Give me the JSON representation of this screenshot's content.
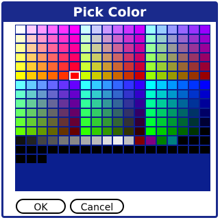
{
  "dialog": {
    "title": "Pick Color",
    "ok_label": "OK",
    "cancel_label": "Cancel"
  },
  "palette": {
    "columns": 18,
    "border_color": "#0b1f8e",
    "selected_index": 95,
    "colors": [
      "#ffffff",
      "#ffccff",
      "#ff99ff",
      "#ff66ff",
      "#ff33ff",
      "#ff00ff",
      "#ccffff",
      "#ccccff",
      "#cc99ff",
      "#cc66ff",
      "#cc33ff",
      "#cc00ff",
      "#99ffff",
      "#99ccff",
      "#9999ff",
      "#9966ff",
      "#9933ff",
      "#9900ff",
      "#ffffcc",
      "#ffcccc",
      "#ff99cc",
      "#ff66cc",
      "#ff33cc",
      "#ff00cc",
      "#ccffcc",
      "#cccccc",
      "#cc99cc",
      "#cc66cc",
      "#cc33cc",
      "#cc00cc",
      "#99ffcc",
      "#99cccc",
      "#9999cc",
      "#9966cc",
      "#9933cc",
      "#9900cc",
      "#ffff99",
      "#ffcc99",
      "#ff9999",
      "#ff6699",
      "#ff3399",
      "#ff0099",
      "#ccff99",
      "#cccc99",
      "#cc9999",
      "#cc6699",
      "#cc3399",
      "#cc0099",
      "#99ff99",
      "#99cc99",
      "#999999",
      "#996699",
      "#993399",
      "#990099",
      "#ffff66",
      "#ffcc66",
      "#ff9966",
      "#ff6666",
      "#ff3366",
      "#ff0066",
      "#ccff66",
      "#cccc66",
      "#cc9966",
      "#cc6666",
      "#cc3366",
      "#cc0066",
      "#99ff66",
      "#99cc66",
      "#999966",
      "#996666",
      "#993366",
      "#990066",
      "#ffff33",
      "#ffcc33",
      "#ff9933",
      "#ff6633",
      "#ff3333",
      "#ff0033",
      "#ccff33",
      "#cccc33",
      "#cc9933",
      "#cc6633",
      "#cc3333",
      "#cc0033",
      "#99ff33",
      "#99cc33",
      "#999933",
      "#996633",
      "#993333",
      "#990033",
      "#ffff00",
      "#ffcc00",
      "#ff9900",
      "#ff6600",
      "#ff3300",
      "#ff0000",
      "#ccff00",
      "#cccc00",
      "#cc9900",
      "#cc6600",
      "#cc3300",
      "#cc0000",
      "#99ff00",
      "#99cc00",
      "#999900",
      "#996600",
      "#993300",
      "#990000",
      "#66ffff",
      "#66ccff",
      "#6699ff",
      "#6666ff",
      "#6633ff",
      "#6600ff",
      "#33ffff",
      "#33ccff",
      "#3399ff",
      "#3366ff",
      "#3333ff",
      "#3300ff",
      "#00ffff",
      "#00ccff",
      "#0099ff",
      "#0066ff",
      "#0033ff",
      "#0000ff",
      "#66ffcc",
      "#66cccc",
      "#6699cc",
      "#6666cc",
      "#6633cc",
      "#6600cc",
      "#33ffcc",
      "#33cccc",
      "#3399cc",
      "#3366cc",
      "#3333cc",
      "#3300cc",
      "#00ffcc",
      "#00cccc",
      "#0099cc",
      "#0066cc",
      "#0033cc",
      "#0000cc",
      "#66ff99",
      "#66cc99",
      "#669999",
      "#666699",
      "#663399",
      "#660099",
      "#33ff99",
      "#33cc99",
      "#339999",
      "#336699",
      "#333399",
      "#330099",
      "#00ff99",
      "#00cc99",
      "#009999",
      "#006699",
      "#003399",
      "#000099",
      "#66ff66",
      "#66cc66",
      "#669966",
      "#666666",
      "#663366",
      "#660066",
      "#33ff66",
      "#33cc66",
      "#339966",
      "#336666",
      "#333366",
      "#330066",
      "#00ff66",
      "#00cc66",
      "#009966",
      "#006666",
      "#003366",
      "#000066",
      "#66ff33",
      "#66cc33",
      "#669933",
      "#666633",
      "#663333",
      "#660033",
      "#33ff33",
      "#33cc33",
      "#339933",
      "#336633",
      "#333333",
      "#330033",
      "#00ff33",
      "#00cc33",
      "#009933",
      "#006633",
      "#003333",
      "#000033",
      "#66ff00",
      "#66cc00",
      "#669900",
      "#666600",
      "#663300",
      "#660000",
      "#33ff00",
      "#33cc00",
      "#339900",
      "#336600",
      "#333300",
      "#330000",
      "#00ff00",
      "#00cc00",
      "#009900",
      "#006600",
      "#003300",
      "#000000",
      "#111111",
      "#222222",
      "#444444",
      "#555555",
      "#777777",
      "#888888",
      "#aaaaaa",
      "#bbbbbb",
      "#dddddd",
      "#eeeeee",
      "#c0c0c0",
      "#800000",
      "#800080",
      "#008000",
      "#008080",
      "#000000",
      "#000000",
      "#000000",
      "#000000",
      "#000000",
      "#000000",
      "#000000",
      "#000000",
      "#000000",
      "#000000",
      "#000000",
      "#000000",
      "#000000",
      "#000000",
      "#000000",
      "#000000",
      "#000000",
      "#000000",
      "#000000",
      "#000000",
      "#000000",
      "#000000",
      "#000000",
      "#000000",
      "#0b1f8e",
      "#0b1f8e",
      "#0b1f8e",
      "#0b1f8e",
      "#0b1f8e",
      "#0b1f8e",
      "#0b1f8e",
      "#0b1f8e",
      "#0b1f8e",
      "#0b1f8e",
      "#0b1f8e",
      "#0b1f8e",
      "#0b1f8e",
      "#0b1f8e",
      "#0b1f8e"
    ]
  }
}
